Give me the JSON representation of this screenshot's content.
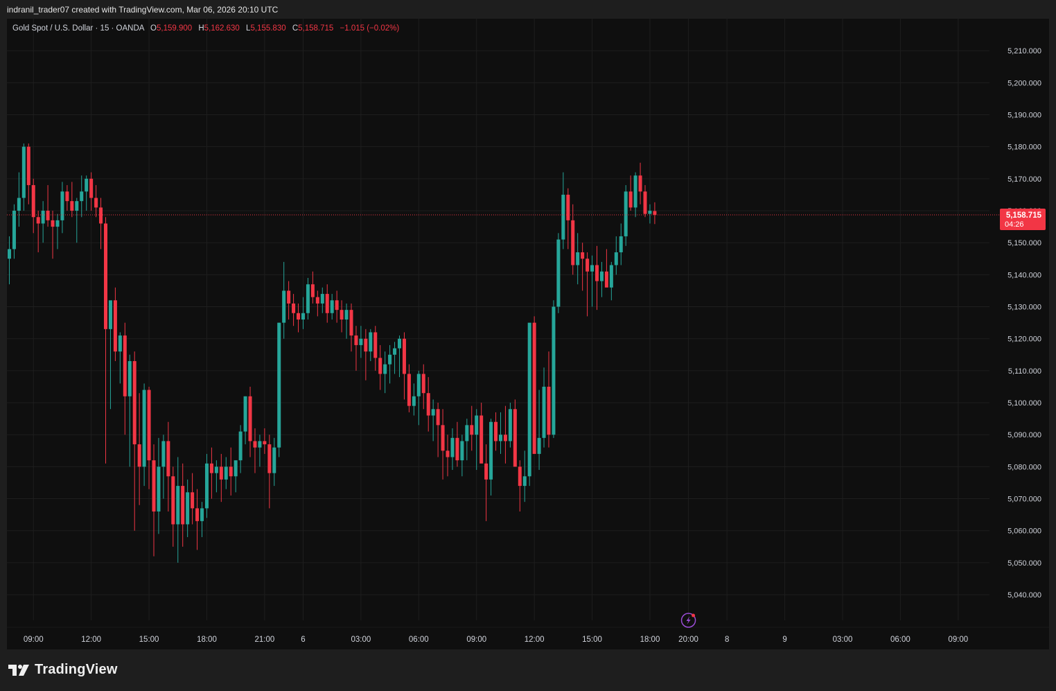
{
  "header": {
    "caption": "indranil_trader07 created with TradingView.com, Mar 06, 2026 20:10 UTC"
  },
  "legend": {
    "symbol": "Gold Spot / U.S. Dollar · 15 · OANDA",
    "open_label": "O",
    "open": "5,159.900",
    "high_label": "H",
    "high": "5,162.630",
    "low_label": "L",
    "low": "5,155.830",
    "close_label": "C",
    "close": "5,158.715",
    "change": "−1.015 (−0.02%)"
  },
  "price_tag": {
    "price": "5,158.715",
    "countdown": "04:26",
    "price_value": 5158.715
  },
  "footer": {
    "brand": "TradingView",
    "logo_icon": "tradingview-logo-icon"
  },
  "colors": {
    "up": "#26a69a",
    "down": "#f23645",
    "background": "#0f0f0f",
    "grid": "#1e1e1e",
    "price_line": "#f23645"
  },
  "chart_data": {
    "type": "candlestick",
    "title": "Gold Spot / U.S. Dollar",
    "interval": "15",
    "source": "OANDA",
    "ylim": [
      5032,
      5220
    ],
    "y_ticks": [
      {
        "label": "5,210.000",
        "v": 5210
      },
      {
        "label": "5,200.000",
        "v": 5200
      },
      {
        "label": "5,190.000",
        "v": 5190
      },
      {
        "label": "5,180.000",
        "v": 5180
      },
      {
        "label": "5,170.000",
        "v": 5170
      },
      {
        "label": "5,160.000",
        "v": 5160
      },
      {
        "label": "5,150.000",
        "v": 5150
      },
      {
        "label": "5,140.000",
        "v": 5140
      },
      {
        "label": "5,130.000",
        "v": 5130
      },
      {
        "label": "5,120.000",
        "v": 5120
      },
      {
        "label": "5,110.000",
        "v": 5110
      },
      {
        "label": "5,100.000",
        "v": 5100
      },
      {
        "label": "5,090.000",
        "v": 5090
      },
      {
        "label": "5,080.000",
        "v": 5080
      },
      {
        "label": "5,070.000",
        "v": 5070
      },
      {
        "label": "5,060.000",
        "v": 5060
      },
      {
        "label": "5,050.000",
        "v": 5050
      },
      {
        "label": "5,040.000",
        "v": 5040
      }
    ],
    "x_ticks": [
      {
        "label": "09:00",
        "i": 5
      },
      {
        "label": "12:00",
        "i": 17
      },
      {
        "label": "15:00",
        "i": 29
      },
      {
        "label": "18:00",
        "i": 41
      },
      {
        "label": "21:00",
        "i": 53
      },
      {
        "label": "6",
        "i": 61
      },
      {
        "label": "03:00",
        "i": 73
      },
      {
        "label": "06:00",
        "i": 85
      },
      {
        "label": "09:00",
        "i": 97
      },
      {
        "label": "12:00",
        "i": 109
      },
      {
        "label": "15:00",
        "i": 121
      },
      {
        "label": "18:00",
        "i": 133
      },
      {
        "label": "20:00",
        "i": 141
      },
      {
        "label": "8",
        "i": 149
      },
      {
        "label": "9",
        "i": 161
      },
      {
        "label": "03:00",
        "i": 173
      },
      {
        "label": "06:00",
        "i": 185
      },
      {
        "label": "09:00",
        "i": 197
      }
    ],
    "x_slots": 204,
    "candles": [
      [
        5145,
        5152,
        5137,
        5148
      ],
      [
        5148,
        5162,
        5145,
        5160
      ],
      [
        5160,
        5172,
        5155,
        5164
      ],
      [
        5164,
        5181,
        5160,
        5180
      ],
      [
        5180,
        5181,
        5162,
        5168
      ],
      [
        5168,
        5170,
        5153,
        5158
      ],
      [
        5158,
        5160,
        5147,
        5156
      ],
      [
        5156,
        5163,
        5150,
        5160
      ],
      [
        5160,
        5168,
        5155,
        5157
      ],
      [
        5157,
        5160,
        5145,
        5155
      ],
      [
        5155,
        5159,
        5148,
        5157
      ],
      [
        5157,
        5169,
        5153,
        5166
      ],
      [
        5166,
        5168,
        5160,
        5163
      ],
      [
        5163,
        5169,
        5158,
        5160
      ],
      [
        5160,
        5164,
        5150,
        5163
      ],
      [
        5163,
        5171,
        5158,
        5166
      ],
      [
        5166,
        5171,
        5160,
        5170
      ],
      [
        5170,
        5172,
        5160,
        5164
      ],
      [
        5164,
        5168,
        5158,
        5161
      ],
      [
        5161,
        5164,
        5148,
        5156
      ],
      [
        5156,
        5158,
        5081,
        5123
      ],
      [
        5123,
        5130,
        5098,
        5132
      ],
      [
        5132,
        5136,
        5113,
        5116
      ],
      [
        5116,
        5122,
        5106,
        5121
      ],
      [
        5121,
        5125,
        5090,
        5102
      ],
      [
        5102,
        5115,
        5080,
        5113
      ],
      [
        5113,
        5116,
        5060,
        5087
      ],
      [
        5087,
        5103,
        5068,
        5080
      ],
      [
        5080,
        5106,
        5074,
        5104
      ],
      [
        5104,
        5105,
        5073,
        5082
      ],
      [
        5082,
        5087,
        5052,
        5066
      ],
      [
        5066,
        5089,
        5059,
        5080
      ],
      [
        5080,
        5090,
        5070,
        5088
      ],
      [
        5088,
        5094,
        5066,
        5077
      ],
      [
        5077,
        5080,
        5055,
        5062
      ],
      [
        5062,
        5083,
        5050,
        5074
      ],
      [
        5074,
        5081,
        5055,
        5062
      ],
      [
        5062,
        5076,
        5058,
        5072
      ],
      [
        5072,
        5078,
        5062,
        5067
      ],
      [
        5067,
        5073,
        5054,
        5063
      ],
      [
        5063,
        5069,
        5058,
        5067
      ],
      [
        5067,
        5084,
        5064,
        5081
      ],
      [
        5081,
        5086,
        5070,
        5078
      ],
      [
        5078,
        5082,
        5072,
        5080
      ],
      [
        5080,
        5084,
        5069,
        5076
      ],
      [
        5076,
        5083,
        5073,
        5080
      ],
      [
        5080,
        5086,
        5071,
        5077
      ],
      [
        5077,
        5082,
        5072,
        5082
      ],
      [
        5082,
        5093,
        5078,
        5091
      ],
      [
        5091,
        5102,
        5087,
        5102
      ],
      [
        5102,
        5105,
        5083,
        5088
      ],
      [
        5088,
        5092,
        5078,
        5086
      ],
      [
        5086,
        5090,
        5080,
        5088
      ],
      [
        5088,
        5092,
        5084,
        5087
      ],
      [
        5087,
        5090,
        5067,
        5078
      ],
      [
        5078,
        5089,
        5074,
        5086
      ],
      [
        5086,
        5125,
        5083,
        5125
      ],
      [
        5125,
        5144,
        5120,
        5135
      ],
      [
        5135,
        5138,
        5126,
        5131
      ],
      [
        5131,
        5134,
        5124,
        5128
      ],
      [
        5128,
        5131,
        5122,
        5126
      ],
      [
        5126,
        5133,
        5123,
        5128
      ],
      [
        5128,
        5139,
        5126,
        5137
      ],
      [
        5137,
        5141,
        5131,
        5133
      ],
      [
        5133,
        5135,
        5127,
        5131
      ],
      [
        5131,
        5136,
        5128,
        5134
      ],
      [
        5134,
        5137,
        5125,
        5128
      ],
      [
        5128,
        5134,
        5126,
        5132
      ],
      [
        5132,
        5135,
        5125,
        5129
      ],
      [
        5129,
        5132,
        5122,
        5126
      ],
      [
        5126,
        5131,
        5120,
        5129
      ],
      [
        5129,
        5131,
        5116,
        5121
      ],
      [
        5121,
        5124,
        5110,
        5118
      ],
      [
        5118,
        5124,
        5114,
        5120
      ],
      [
        5120,
        5123,
        5107,
        5116
      ],
      [
        5116,
        5123,
        5113,
        5122
      ],
      [
        5122,
        5124,
        5110,
        5114
      ],
      [
        5114,
        5118,
        5104,
        5109
      ],
      [
        5109,
        5116,
        5103,
        5112
      ],
      [
        5112,
        5118,
        5106,
        5115
      ],
      [
        5115,
        5119,
        5109,
        5117
      ],
      [
        5117,
        5121,
        5108,
        5120
      ],
      [
        5120,
        5122,
        5101,
        5109
      ],
      [
        5109,
        5112,
        5097,
        5099
      ],
      [
        5099,
        5106,
        5096,
        5102
      ],
      [
        5102,
        5110,
        5093,
        5109
      ],
      [
        5109,
        5112,
        5098,
        5103
      ],
      [
        5103,
        5108,
        5091,
        5096
      ],
      [
        5096,
        5101,
        5088,
        5098
      ],
      [
        5098,
        5100,
        5083,
        5093
      ],
      [
        5093,
        5098,
        5076,
        5085
      ],
      [
        5085,
        5090,
        5077,
        5083
      ],
      [
        5083,
        5092,
        5079,
        5089
      ],
      [
        5089,
        5094,
        5080,
        5082
      ],
      [
        5082,
        5090,
        5077,
        5088
      ],
      [
        5088,
        5095,
        5082,
        5093
      ],
      [
        5093,
        5099,
        5085,
        5090
      ],
      [
        5090,
        5098,
        5079,
        5096
      ],
      [
        5096,
        5100,
        5085,
        5081
      ],
      [
        5081,
        5087,
        5063,
        5076
      ],
      [
        5076,
        5095,
        5071,
        5094
      ],
      [
        5094,
        5097,
        5085,
        5088
      ],
      [
        5088,
        5097,
        5084,
        5090
      ],
      [
        5090,
        5099,
        5081,
        5088
      ],
      [
        5088,
        5100,
        5086,
        5098
      ],
      [
        5098,
        5101,
        5080,
        5080
      ],
      [
        5080,
        5082,
        5066,
        5074
      ],
      [
        5074,
        5085,
        5069,
        5077
      ],
      [
        5077,
        5117,
        5074,
        5125
      ],
      [
        5125,
        5127,
        5085,
        5084
      ],
      [
        5084,
        5104,
        5079,
        5089
      ],
      [
        5089,
        5111,
        5086,
        5105
      ],
      [
        5105,
        5116,
        5086,
        5090
      ],
      [
        5090,
        5132,
        5089,
        5130
      ],
      [
        5130,
        5153,
        5128,
        5151
      ],
      [
        5151,
        5172,
        5148,
        5165
      ],
      [
        5165,
        5167,
        5148,
        5157
      ],
      [
        5157,
        5162,
        5140,
        5143
      ],
      [
        5143,
        5153,
        5137,
        5147
      ],
      [
        5147,
        5150,
        5135,
        5145
      ],
      [
        5145,
        5147,
        5127,
        5141
      ],
      [
        5141,
        5146,
        5130,
        5143
      ],
      [
        5143,
        5149,
        5129,
        5138
      ],
      [
        5138,
        5144,
        5133,
        5141
      ],
      [
        5141,
        5148,
        5137,
        5136
      ],
      [
        5136,
        5144,
        5132,
        5143
      ],
      [
        5143,
        5152,
        5140,
        5147
      ],
      [
        5147,
        5156,
        5143,
        5152
      ],
      [
        5152,
        5168,
        5149,
        5166
      ],
      [
        5166,
        5171,
        5160,
        5161
      ],
      [
        5161,
        5172,
        5158,
        5171
      ],
      [
        5171,
        5175,
        5162,
        5166
      ],
      [
        5166,
        5168,
        5158,
        5159
      ],
      [
        5159,
        5162,
        5156,
        5160
      ],
      [
        5159.9,
        5162.63,
        5155.83,
        5158.715
      ]
    ]
  }
}
